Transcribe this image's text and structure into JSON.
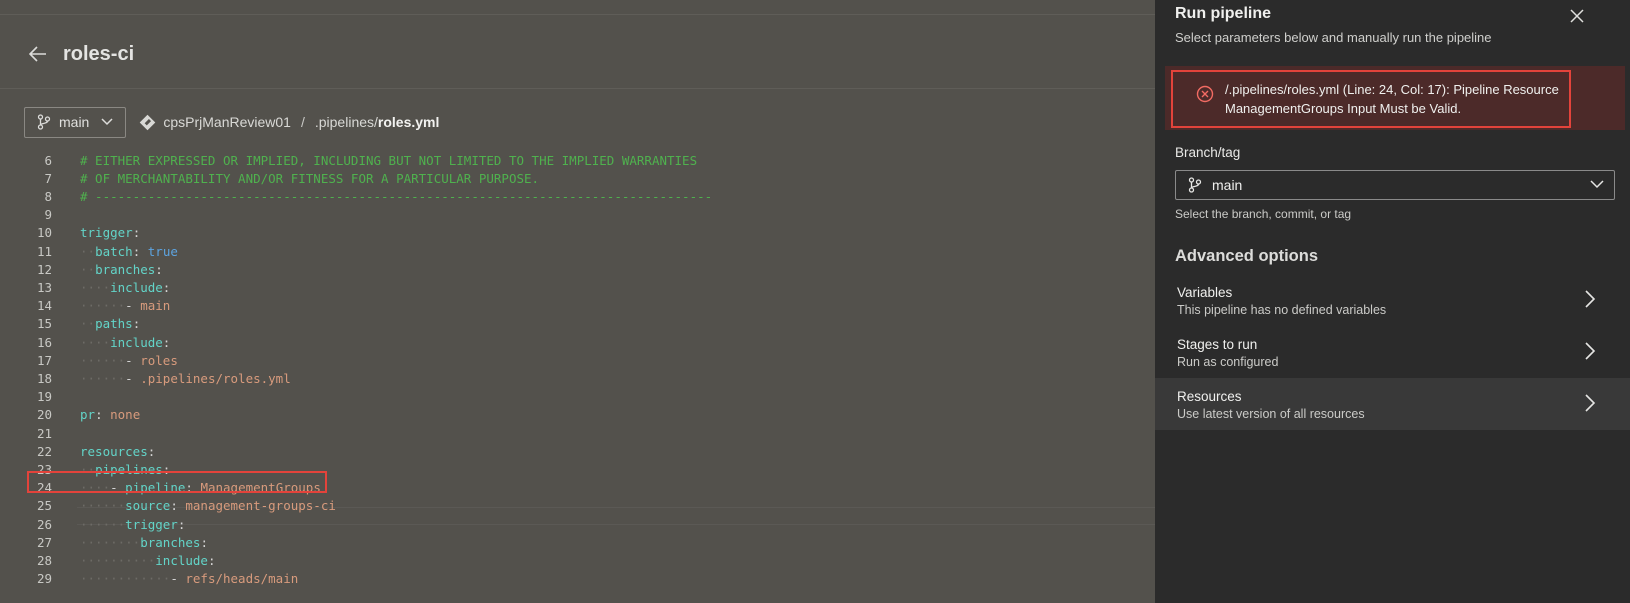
{
  "page": {
    "title": "roles-ci",
    "branch": "main",
    "breadcrumb": {
      "repo": "cpsPrjManReview01",
      "separator": "/",
      "path_prefix": ".pipelines/",
      "file": "roles.yml"
    }
  },
  "code_lines": [
    {
      "n": "6",
      "segs": [
        [
          "c-comment",
          "# EITHER EXPRESSED OR IMPLIED, INCLUDING BUT NOT LIMITED TO THE IMPLIED WARRANTIES"
        ]
      ]
    },
    {
      "n": "7",
      "segs": [
        [
          "c-comment",
          "# OF MERCHANTABILITY AND/OR FITNESS FOR A PARTICULAR PURPOSE."
        ]
      ]
    },
    {
      "n": "8",
      "segs": [
        [
          "c-comment",
          "# ----------------------------------------------------------------------------------"
        ]
      ]
    },
    {
      "n": "9",
      "segs": []
    },
    {
      "n": "10",
      "segs": [
        [
          "c-key",
          "trigger"
        ],
        [
          "c-punc",
          ":"
        ]
      ]
    },
    {
      "n": "11",
      "segs": [
        [
          "ws",
          "  "
        ],
        [
          "c-key",
          "batch"
        ],
        [
          "c-punc",
          ": "
        ],
        [
          "c-bool",
          "true"
        ]
      ]
    },
    {
      "n": "12",
      "segs": [
        [
          "ws",
          "  "
        ],
        [
          "c-key",
          "branches"
        ],
        [
          "c-punc",
          ":"
        ]
      ]
    },
    {
      "n": "13",
      "segs": [
        [
          "ws",
          "    "
        ],
        [
          "c-key",
          "include"
        ],
        [
          "c-punc",
          ":"
        ]
      ]
    },
    {
      "n": "14",
      "segs": [
        [
          "ws",
          "      "
        ],
        [
          "c-punc",
          "- "
        ],
        [
          "c-val",
          "main"
        ]
      ]
    },
    {
      "n": "15",
      "segs": [
        [
          "ws",
          "  "
        ],
        [
          "c-key",
          "paths"
        ],
        [
          "c-punc",
          ":"
        ]
      ]
    },
    {
      "n": "16",
      "segs": [
        [
          "ws",
          "    "
        ],
        [
          "c-key",
          "include"
        ],
        [
          "c-punc",
          ":"
        ]
      ]
    },
    {
      "n": "17",
      "segs": [
        [
          "ws",
          "      "
        ],
        [
          "c-punc",
          "- "
        ],
        [
          "c-val",
          "roles"
        ]
      ]
    },
    {
      "n": "18",
      "segs": [
        [
          "ws",
          "      "
        ],
        [
          "c-punc",
          "- "
        ],
        [
          "c-val",
          ".pipelines/roles.yml"
        ]
      ]
    },
    {
      "n": "19",
      "segs": []
    },
    {
      "n": "20",
      "segs": [
        [
          "c-key",
          "pr"
        ],
        [
          "c-punc",
          ": "
        ],
        [
          "c-val",
          "none"
        ]
      ]
    },
    {
      "n": "21",
      "segs": []
    },
    {
      "n": "22",
      "segs": [
        [
          "c-key",
          "resources"
        ],
        [
          "c-punc",
          ":"
        ]
      ]
    },
    {
      "n": "23",
      "segs": [
        [
          "ws",
          "  "
        ],
        [
          "c-key",
          "pipelines"
        ],
        [
          "c-punc",
          ":"
        ]
      ]
    },
    {
      "n": "24",
      "segs": [
        [
          "ws",
          "    "
        ],
        [
          "c-punc",
          "- "
        ],
        [
          "c-key",
          "pipeline"
        ],
        [
          "c-punc",
          ": "
        ],
        [
          "c-val",
          "ManagementGroups"
        ]
      ]
    },
    {
      "n": "25",
      "segs": [
        [
          "ws",
          "      "
        ],
        [
          "c-key",
          "source"
        ],
        [
          "c-punc",
          ": "
        ],
        [
          "c-val",
          "management-groups-ci"
        ]
      ]
    },
    {
      "n": "26",
      "segs": [
        [
          "ws",
          "      "
        ],
        [
          "c-key",
          "trigger"
        ],
        [
          "c-punc",
          ":"
        ]
      ]
    },
    {
      "n": "27",
      "segs": [
        [
          "ws",
          "        "
        ],
        [
          "c-key",
          "branches"
        ],
        [
          "c-punc",
          ":"
        ]
      ]
    },
    {
      "n": "28",
      "segs": [
        [
          "ws",
          "          "
        ],
        [
          "c-key",
          "include"
        ],
        [
          "c-punc",
          ":"
        ]
      ]
    },
    {
      "n": "29",
      "segs": [
        [
          "ws",
          "            "
        ],
        [
          "c-punc",
          "- "
        ],
        [
          "c-val",
          "refs/heads/main"
        ]
      ]
    }
  ],
  "run_panel": {
    "title": "Run pipeline",
    "subtitle": "Select parameters below and manually run the pipeline",
    "error": "/.pipelines/roles.yml (Line: 24, Col: 17): Pipeline Resource ManagementGroups Input Must be Valid.",
    "branch_label": "Branch/tag",
    "branch_value": "main",
    "branch_help": "Select the branch, commit, or tag",
    "advanced_title": "Advanced options",
    "options": [
      {
        "title": "Variables",
        "desc": "This pipeline has no defined variables"
      },
      {
        "title": "Stages to run",
        "desc": "Run as configured"
      },
      {
        "title": "Resources",
        "desc": "Use latest version of all resources"
      }
    ]
  },
  "colors": {
    "error_border": "#e3433b",
    "comment": "#4fb14e",
    "key": "#63d4c8",
    "string": "#d89b7d",
    "bool": "#5da4e0"
  },
  "icons": [
    "back-arrow-icon",
    "branch-icon",
    "chevron-down-icon",
    "repo-icon",
    "close-icon",
    "error-circle-icon",
    "chevron-right-icon"
  ]
}
